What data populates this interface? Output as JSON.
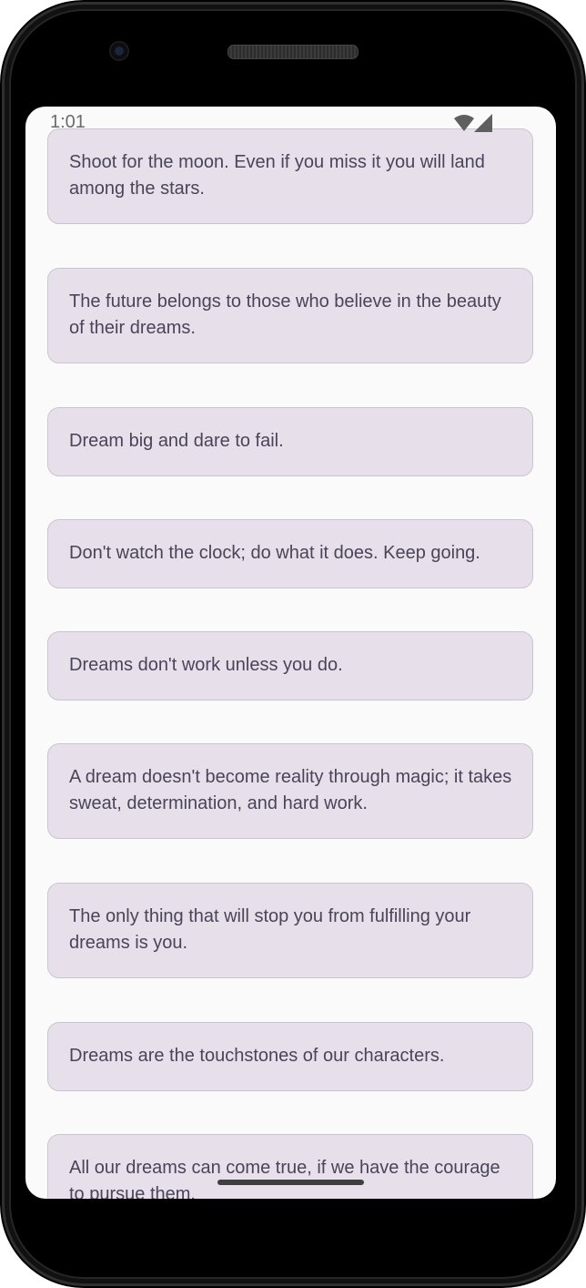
{
  "status_bar": {
    "time": "1:01",
    "wifi_icon": "wifi-icon",
    "signal_icon": "cell-signal-icon"
  },
  "quotes": [
    "Shoot for the moon. Even if you miss it you will land among the stars.",
    "The future belongs to those who believe in the beauty of their dreams.",
    "Dream big and dare to fail.",
    "Don't watch the clock; do what it does. Keep going.",
    "Dreams don't work unless you do.",
    "A dream doesn't become reality through magic; it takes sweat, determination, and hard work.",
    "The only thing that will stop you from fulfilling your dreams is you.",
    "Dreams are the touchstones of our characters.",
    "All our dreams can come true, if we have the courage to pursue them."
  ],
  "colors": {
    "card_background": "#e7e0eb",
    "card_border": "#cac4d0",
    "card_text": "#4a4458",
    "screen_background": "#fafafa"
  }
}
